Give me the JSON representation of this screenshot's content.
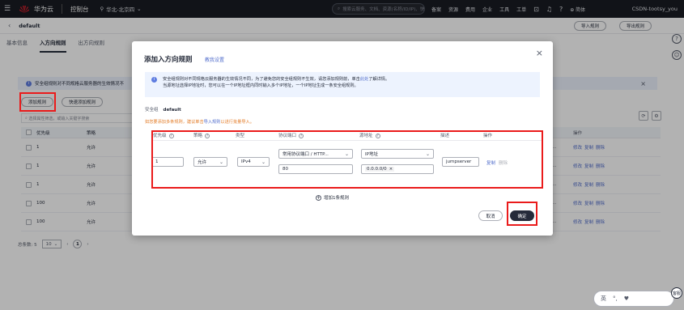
{
  "topbar": {
    "brand": "华为云",
    "console": "控制台",
    "region": "华北-北京四",
    "search_placeholder": "搜索云服务、文档、资源(名称/ID/IP)、快捷...",
    "nav": [
      "备案",
      "资源",
      "费用",
      "企业",
      "工具",
      "工单"
    ],
    "lang": "简体",
    "user": "CSDN-tootsy_you"
  },
  "page": {
    "sg_name": "default",
    "btn_import": "导入规则",
    "btn_export": "导出规则",
    "tabs": [
      "基本信息",
      "入方向规则",
      "出方向规则"
    ],
    "info_text": "安全组规则对不同规格云服务器的生效情况不",
    "btn_add_rule": "添加规则",
    "btn_quick_add": "快速添加规则",
    "filter_placeholder": "选择属性筛选，或输入关键字搜索",
    "table_headers": [
      "优先级",
      "策略",
      "操作"
    ],
    "rows": [
      {
        "priority": "1",
        "policy": "允许",
        "rest": "G...",
        "ops": [
          "修改",
          "复制",
          "删除"
        ]
      },
      {
        "priority": "1",
        "policy": "允许",
        "rest": "G...",
        "ops": [
          "修改",
          "复制",
          "删除"
        ]
      },
      {
        "priority": "1",
        "policy": "允许",
        "rest": "G...",
        "ops": [
          "修改",
          "复制",
          "删除"
        ]
      },
      {
        "priority": "100",
        "policy": "允许",
        "rest": "G...",
        "ops": [
          "修改",
          "复制",
          "删除"
        ]
      },
      {
        "priority": "100",
        "policy": "允许",
        "rest": "G...",
        "ops": [
          "修改",
          "复制",
          "删除"
        ]
      }
    ],
    "pager": {
      "total": "总条数: 5",
      "page_size": "10",
      "current": "1"
    }
  },
  "modal": {
    "title": "添加入方向规则",
    "help_link": "教我设置",
    "notice_line1": "安全组规则对不同规格云服务器的生效情况不同，为了避免您的安全组规则不生效，请您添加规则前，单击",
    "notice_link": "此处",
    "notice_line1_end": "了解详情。",
    "notice_line2": "当源地址选择IP地址时，您可以在一个IP地址框内同时输入多个IP地址，一个IP地址生成一条安全组规则。",
    "sg_label": "安全组",
    "sg_value": "default",
    "tip_text": "如您要添加多条规则，建议单击",
    "tip_link": "导入规则",
    "tip_end": "以进行批量导入。",
    "headers": {
      "priority": "优先级",
      "policy": "策略",
      "type": "类型",
      "protocol": "协议端口",
      "source": "源地址",
      "desc": "描述",
      "ops": "操作"
    },
    "rule": {
      "priority": "1",
      "policy": "允许",
      "type": "IPv4",
      "protocol": "常用协议端口 / HTTP...",
      "port": "80",
      "source_type": "IP地址",
      "source_ip": "0.0.0.0/0",
      "desc": "jumpserver",
      "op_copy": "复制",
      "op_delete": "删除"
    },
    "add_more": "增加1条规则",
    "cancel": "取消",
    "ok": "确定"
  },
  "chatbot": {
    "label": "英",
    "bubble": "客服"
  },
  "colors": {
    "accent": "#526ecc",
    "highlight": "#ea1b1b",
    "topbar": "#191c23",
    "warning": "#e37d29"
  }
}
